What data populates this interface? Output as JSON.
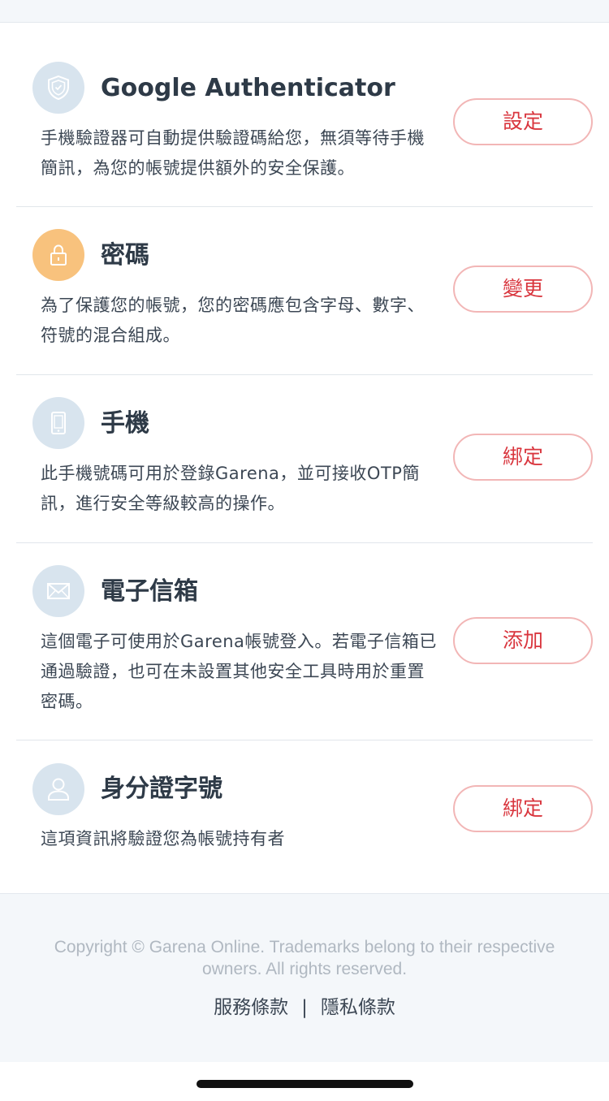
{
  "colors": {
    "accent": "#d9363e",
    "button_border": "#f2b6b6",
    "icon_bg": "#d8e4ee",
    "icon_bg_password": "#f8c27d",
    "title": "#2e3a47",
    "footer_bg": "#f4f7fa"
  },
  "sections": [
    {
      "icon": "shield-icon",
      "title": "Google Authenticator",
      "description": "手機驗證器可自動提供驗證碼給您，無須等待手機簡訊，為您的帳號提供額外的安全保護。",
      "button": "設定"
    },
    {
      "icon": "lock-icon",
      "title": "密碼",
      "description": "為了保護您的帳號，您的密碼應包含字母、數字、符號的混合組成。",
      "button": "變更"
    },
    {
      "icon": "phone-icon",
      "title": "手機",
      "description": "此手機號碼可用於登錄Garena，並可接收OTP簡訊，進行安全等級較高的操作。",
      "button": "綁定"
    },
    {
      "icon": "mail-icon",
      "title": "電子信箱",
      "description": "這個電子可使用於Garena帳號登入。若電子信箱已通過驗證，也可在未設置其他安全工具時用於重置密碼。",
      "button": "添加"
    },
    {
      "icon": "user-icon",
      "title": "身分證字號",
      "description": "這項資訊將驗證您為帳號持有者",
      "button": "綁定"
    }
  ],
  "footer": {
    "copyright": "Copyright © Garena Online. Trademarks belong to their respective owners. All rights reserved.",
    "terms": "服務條款",
    "separator": "|",
    "privacy": "隱私條款"
  }
}
